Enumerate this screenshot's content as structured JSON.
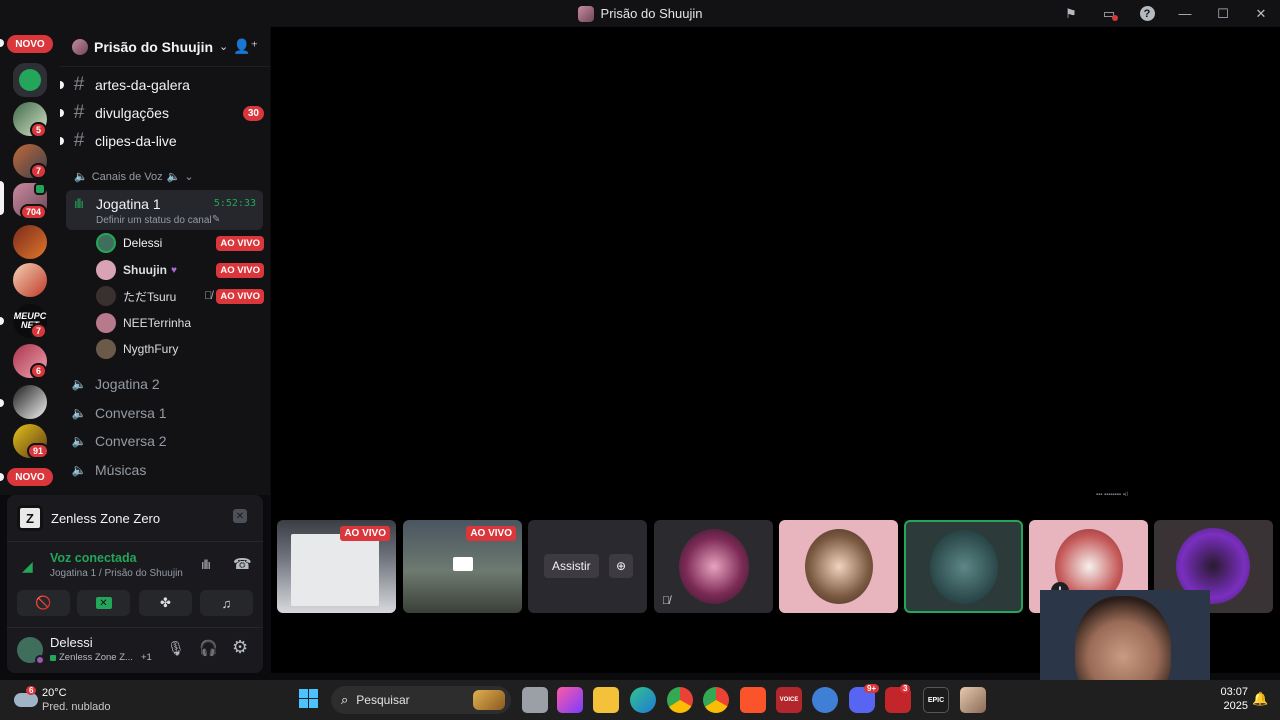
{
  "window": {
    "title": "Prisão do Shuujin"
  },
  "rail": {
    "novo_top": "NOVO",
    "novo_bottom": "NOVO",
    "servers": [
      {
        "icon": "green-server-icon",
        "badge": ""
      },
      {
        "icon": "server-2-icon",
        "badge": "5"
      },
      {
        "icon": "server-3-icon",
        "badge": "7"
      },
      {
        "icon": "server-4-icon",
        "badge": "704"
      },
      {
        "icon": "server-5-icon",
        "badge": ""
      },
      {
        "icon": "server-6-icon",
        "badge": ""
      },
      {
        "icon": "meupc-icon",
        "badge": "7",
        "label": "MEUPC NET"
      },
      {
        "icon": "server-8-icon",
        "badge": "6"
      },
      {
        "icon": "server-9-icon",
        "badge": ""
      },
      {
        "icon": "server-10-icon",
        "badge": "91"
      }
    ]
  },
  "server": {
    "name": "Prisão do Shuujin"
  },
  "channels": [
    {
      "name": "artes-da-galera",
      "count": ""
    },
    {
      "name": "divulgações",
      "count": "30"
    },
    {
      "name": "clipes-da-live",
      "count": ""
    }
  ],
  "voice_category": "Canais de Voz",
  "active_voice": {
    "name": "Jogatina 1",
    "timer": "5:52:33",
    "status": "Definir um status do canal"
  },
  "voice_users": [
    {
      "name": "Delessi",
      "live": "AO VIVO",
      "color": "#3f6f5c"
    },
    {
      "name": "Shuujin",
      "live": "AO VIVO",
      "color": "#d8a3b5"
    },
    {
      "name": "ただTsuru",
      "live": "AO VIVO",
      "color": "#3a3030"
    },
    {
      "name": "NEETerrinha",
      "live": "",
      "color": "#b77a8c"
    },
    {
      "name": "NygthFury",
      "live": "",
      "color": "#6b5a4a"
    }
  ],
  "other_voice": [
    "Jogatina 2",
    "Conversa 1",
    "Conversa 2",
    "Músicas"
  ],
  "activity": {
    "game": "Zenless Zone Zero"
  },
  "connection": {
    "status": "Voz conectada",
    "location": "Jogatina 1 / Prisão do Shuujin"
  },
  "account": {
    "name": "Delessi",
    "status": "Zenless Zone Z...",
    "extra": "+1"
  },
  "stage": {
    "tiles": [
      {
        "live": "AO VIVO"
      },
      {
        "live": "AO VIVO"
      },
      {
        "live": "",
        "watch": "Assistir"
      },
      {
        "live": ""
      },
      {
        "live": ""
      },
      {
        "live": ""
      },
      {
        "live": ""
      },
      {
        "live": ""
      }
    ]
  },
  "taskbar": {
    "weather_temp": "20°C",
    "weather_desc": "Pred. nublado",
    "weather_badge": "6",
    "search": "Pesquisar",
    "time": "03:07",
    "date": "2025",
    "discord_badge": "9+",
    "app_badge": "3"
  }
}
